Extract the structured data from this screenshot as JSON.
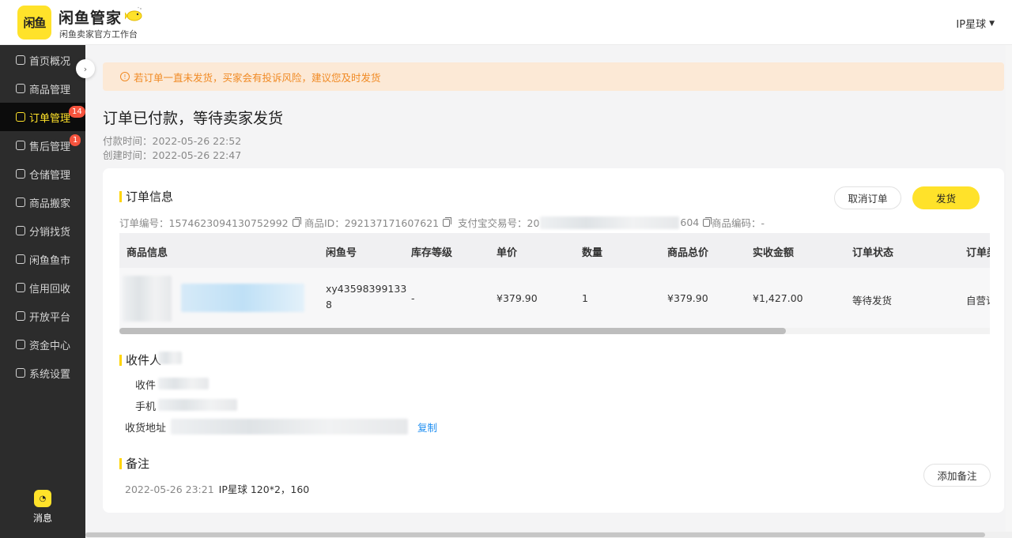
{
  "header": {
    "logo_text": "闲鱼",
    "brand_title": "闲鱼管家",
    "brand_subtitle": "闲鱼卖家官方工作台",
    "user_name": "IP星球",
    "colors": {
      "brand": "#ffe22a",
      "accent": "#ffd400"
    }
  },
  "sidebar": {
    "items": [
      {
        "label": "首页概况",
        "icon": "grid-icon"
      },
      {
        "label": "商品管理",
        "icon": "bag-icon"
      },
      {
        "label": "订单管理",
        "icon": "order-icon",
        "badge": "14",
        "active": true
      },
      {
        "label": "售后管理",
        "icon": "service-icon",
        "badge": "1"
      },
      {
        "label": "仓储管理",
        "icon": "warehouse-icon"
      },
      {
        "label": "商品搬家",
        "icon": "move-icon"
      },
      {
        "label": "分销找货",
        "icon": "distribute-icon"
      },
      {
        "label": "闲鱼鱼市",
        "icon": "market-icon"
      },
      {
        "label": "信用回收",
        "icon": "recycle-icon"
      },
      {
        "label": "开放平台",
        "icon": "platform-icon"
      },
      {
        "label": "资金中心",
        "icon": "fund-icon"
      },
      {
        "label": "系统设置",
        "icon": "gear-icon"
      }
    ],
    "message_label": "消息"
  },
  "notice": {
    "text": "若订单一直未发货，买家会有投诉风险，建议您及时发货"
  },
  "order": {
    "status_title": "订单已付款，等待卖家发货",
    "paid_time": "付款时间：2022-05-26 22:52",
    "created_time": "创建时间：2022-05-26 22:47"
  },
  "order_info": {
    "section_title": "订单信息",
    "cancel_label": "取消订单",
    "ship_label": "发货",
    "order_no": "订单编号：1574623094130752992",
    "product_id": "商品ID：292137171607621",
    "alipay_prefix": "支付宝交易号：20",
    "alipay_suffix": "604",
    "product_code": "商品编码：-",
    "table": {
      "headers": [
        "商品信息",
        "闲鱼号",
        "库存等级",
        "单价",
        "数量",
        "商品总价",
        "实收金额",
        "订单状态",
        "订单类"
      ],
      "row": {
        "xianyu_no": "xy43598399133",
        "xianyu_no_tail": "8",
        "stock_level": "-",
        "unit_price": "¥379.90",
        "quantity": "1",
        "total_price": "¥379.90",
        "received": "¥1,427.00",
        "status": "等待发货",
        "type": "自营订"
      }
    }
  },
  "receiver": {
    "section_title": "收件人",
    "name_label": "收件",
    "phone_label": "手机",
    "address_label": "收货地址",
    "copy_label": "复制"
  },
  "remark": {
    "section_title": "备注",
    "time": "2022-05-26 23:21",
    "content": "IP星球 120*2，160",
    "add_label": "添加备注"
  }
}
